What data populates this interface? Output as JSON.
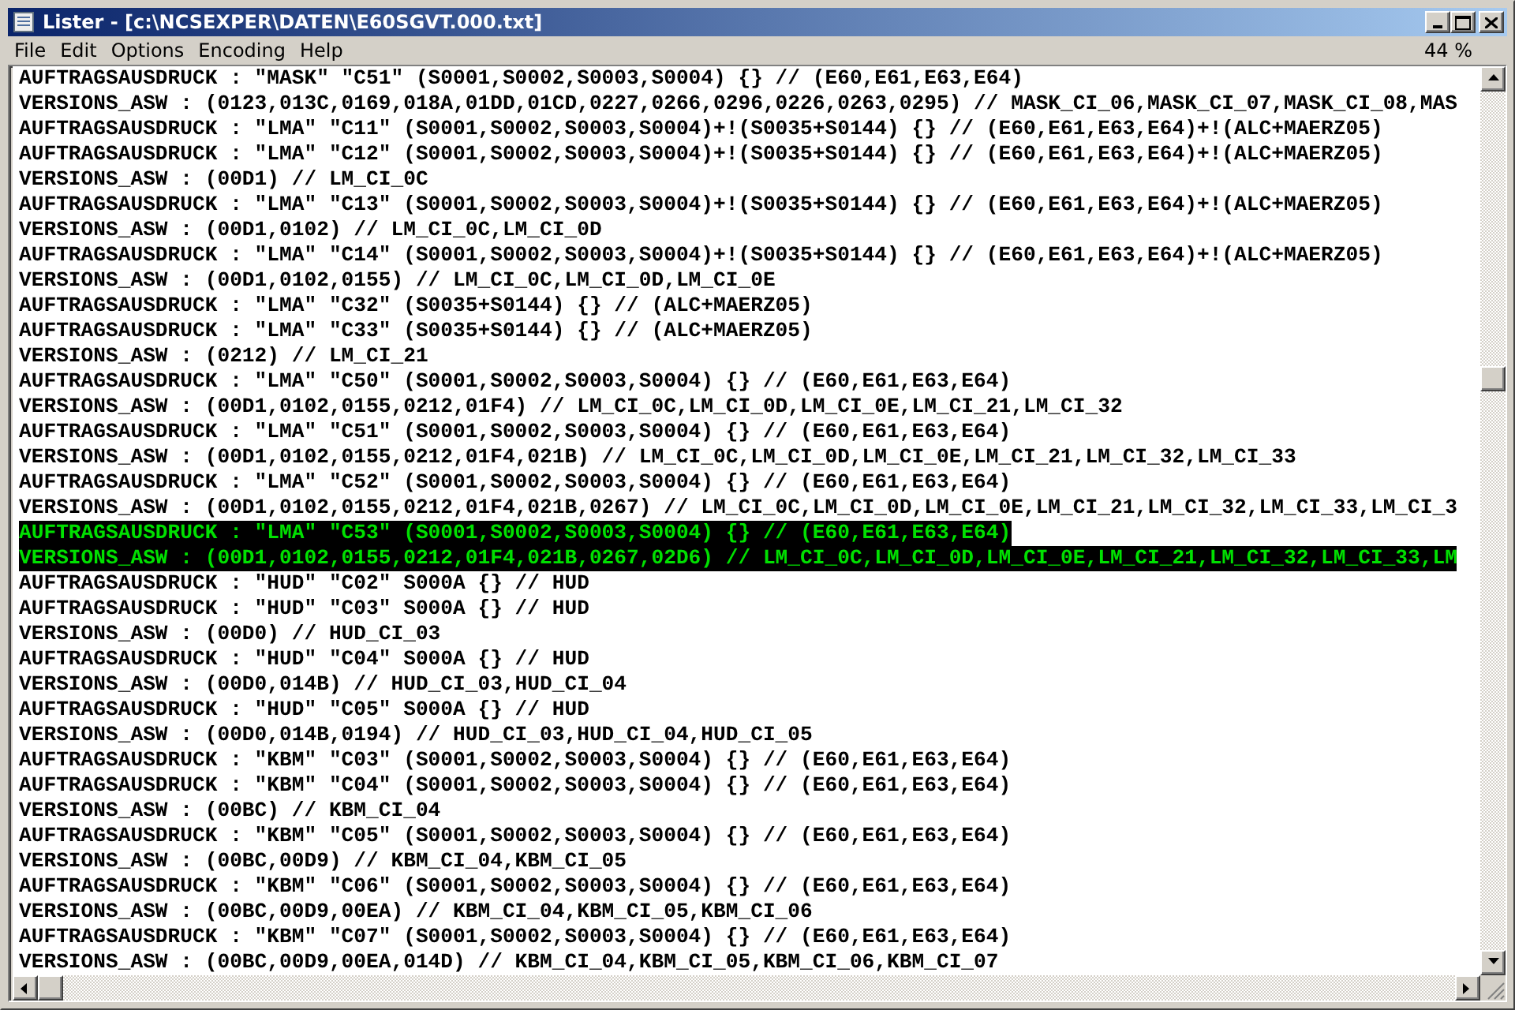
{
  "window": {
    "title": "Lister - [c:\\NCSEXPER\\DATEN\\E60SGVT.000.txt]"
  },
  "menu": [
    "File",
    "Edit",
    "Options",
    "Encoding",
    "Help"
  ],
  "zoom": "44 %",
  "lines": [
    {
      "text": "AUFTRAGSAUSDRUCK : \"MASK\" \"C51\" (S0001,S0002,S0003,S0004) {} // (E60,E61,E63,E64)",
      "selected": false
    },
    {
      "text": "VERSIONS_ASW : (0123,013C,0169,018A,01DD,01CD,0227,0266,0296,0226,0263,0295) // MASK_CI_06,MASK_CI_07,MASK_CI_08,MAS",
      "selected": false
    },
    {
      "text": "AUFTRAGSAUSDRUCK : \"LMA\" \"C11\" (S0001,S0002,S0003,S0004)+!(S0035+S0144) {} // (E60,E61,E63,E64)+!(ALC+MAERZ05)",
      "selected": false
    },
    {
      "text": "AUFTRAGSAUSDRUCK : \"LMA\" \"C12\" (S0001,S0002,S0003,S0004)+!(S0035+S0144) {} // (E60,E61,E63,E64)+!(ALC+MAERZ05)",
      "selected": false
    },
    {
      "text": "VERSIONS_ASW : (00D1) // LM_CI_0C",
      "selected": false
    },
    {
      "text": "AUFTRAGSAUSDRUCK : \"LMA\" \"C13\" (S0001,S0002,S0003,S0004)+!(S0035+S0144) {} // (E60,E61,E63,E64)+!(ALC+MAERZ05)",
      "selected": false
    },
    {
      "text": "VERSIONS_ASW : (00D1,0102) // LM_CI_0C,LM_CI_0D",
      "selected": false
    },
    {
      "text": "AUFTRAGSAUSDRUCK : \"LMA\" \"C14\" (S0001,S0002,S0003,S0004)+!(S0035+S0144) {} // (E60,E61,E63,E64)+!(ALC+MAERZ05)",
      "selected": false
    },
    {
      "text": "VERSIONS_ASW : (00D1,0102,0155) // LM_CI_0C,LM_CI_0D,LM_CI_0E",
      "selected": false
    },
    {
      "text": "AUFTRAGSAUSDRUCK : \"LMA\" \"C32\" (S0035+S0144) {} // (ALC+MAERZ05)",
      "selected": false
    },
    {
      "text": "AUFTRAGSAUSDRUCK : \"LMA\" \"C33\" (S0035+S0144) {} // (ALC+MAERZ05)",
      "selected": false
    },
    {
      "text": "VERSIONS_ASW : (0212) // LM_CI_21",
      "selected": false
    },
    {
      "text": "AUFTRAGSAUSDRUCK : \"LMA\" \"C50\" (S0001,S0002,S0003,S0004) {} // (E60,E61,E63,E64)",
      "selected": false
    },
    {
      "text": "VERSIONS_ASW : (00D1,0102,0155,0212,01F4) // LM_CI_0C,LM_CI_0D,LM_CI_0E,LM_CI_21,LM_CI_32",
      "selected": false
    },
    {
      "text": "AUFTRAGSAUSDRUCK : \"LMA\" \"C51\" (S0001,S0002,S0003,S0004) {} // (E60,E61,E63,E64)",
      "selected": false
    },
    {
      "text": "VERSIONS_ASW : (00D1,0102,0155,0212,01F4,021B) // LM_CI_0C,LM_CI_0D,LM_CI_0E,LM_CI_21,LM_CI_32,LM_CI_33",
      "selected": false
    },
    {
      "text": "AUFTRAGSAUSDRUCK : \"LMA\" \"C52\" (S0001,S0002,S0003,S0004) {} // (E60,E61,E63,E64)",
      "selected": false
    },
    {
      "text": "VERSIONS_ASW : (00D1,0102,0155,0212,01F4,021B,0267) // LM_CI_0C,LM_CI_0D,LM_CI_0E,LM_CI_21,LM_CI_32,LM_CI_33,LM_CI_3",
      "selected": false
    },
    {
      "text": "AUFTRAGSAUSDRUCK : \"LMA\" \"C53\" (S0001,S0002,S0003,S0004) {} // (E60,E61,E63,E64)",
      "selected": true
    },
    {
      "text": "VERSIONS_ASW : (00D1,0102,0155,0212,01F4,021B,0267,02D6) // LM_CI_0C,LM_CI_0D,LM_CI_0E,LM_CI_21,LM_CI_32,LM_CI_33,LM",
      "selected": true
    },
    {
      "text": "AUFTRAGSAUSDRUCK : \"HUD\" \"C02\" S000A {} // HUD",
      "selected": false
    },
    {
      "text": "AUFTRAGSAUSDRUCK : \"HUD\" \"C03\" S000A {} // HUD",
      "selected": false
    },
    {
      "text": "VERSIONS_ASW : (00D0) // HUD_CI_03",
      "selected": false
    },
    {
      "text": "AUFTRAGSAUSDRUCK : \"HUD\" \"C04\" S000A {} // HUD",
      "selected": false
    },
    {
      "text": "VERSIONS_ASW : (00D0,014B) // HUD_CI_03,HUD_CI_04",
      "selected": false
    },
    {
      "text": "AUFTRAGSAUSDRUCK : \"HUD\" \"C05\" S000A {} // HUD",
      "selected": false
    },
    {
      "text": "VERSIONS_ASW : (00D0,014B,0194) // HUD_CI_03,HUD_CI_04,HUD_CI_05",
      "selected": false
    },
    {
      "text": "AUFTRAGSAUSDRUCK : \"KBM\" \"C03\" (S0001,S0002,S0003,S0004) {} // (E60,E61,E63,E64)",
      "selected": false
    },
    {
      "text": "AUFTRAGSAUSDRUCK : \"KBM\" \"C04\" (S0001,S0002,S0003,S0004) {} // (E60,E61,E63,E64)",
      "selected": false
    },
    {
      "text": "VERSIONS_ASW : (00BC) // KBM_CI_04",
      "selected": false
    },
    {
      "text": "AUFTRAGSAUSDRUCK : \"KBM\" \"C05\" (S0001,S0002,S0003,S0004) {} // (E60,E61,E63,E64)",
      "selected": false
    },
    {
      "text": "VERSIONS_ASW : (00BC,00D9) // KBM_CI_04,KBM_CI_05",
      "selected": false
    },
    {
      "text": "AUFTRAGSAUSDRUCK : \"KBM\" \"C06\" (S0001,S0002,S0003,S0004) {} // (E60,E61,E63,E64)",
      "selected": false
    },
    {
      "text": "VERSIONS_ASW : (00BC,00D9,00EA) // KBM_CI_04,KBM_CI_05,KBM_CI_06",
      "selected": false
    },
    {
      "text": "AUFTRAGSAUSDRUCK : \"KBM\" \"C07\" (S0001,S0002,S0003,S0004) {} // (E60,E61,E63,E64)",
      "selected": false
    },
    {
      "text": "VERSIONS_ASW : (00BC,00D9,00EA,014D) // KBM_CI_04,KBM_CI_05,KBM_CI_06,KBM_CI_07",
      "selected": false
    }
  ]
}
